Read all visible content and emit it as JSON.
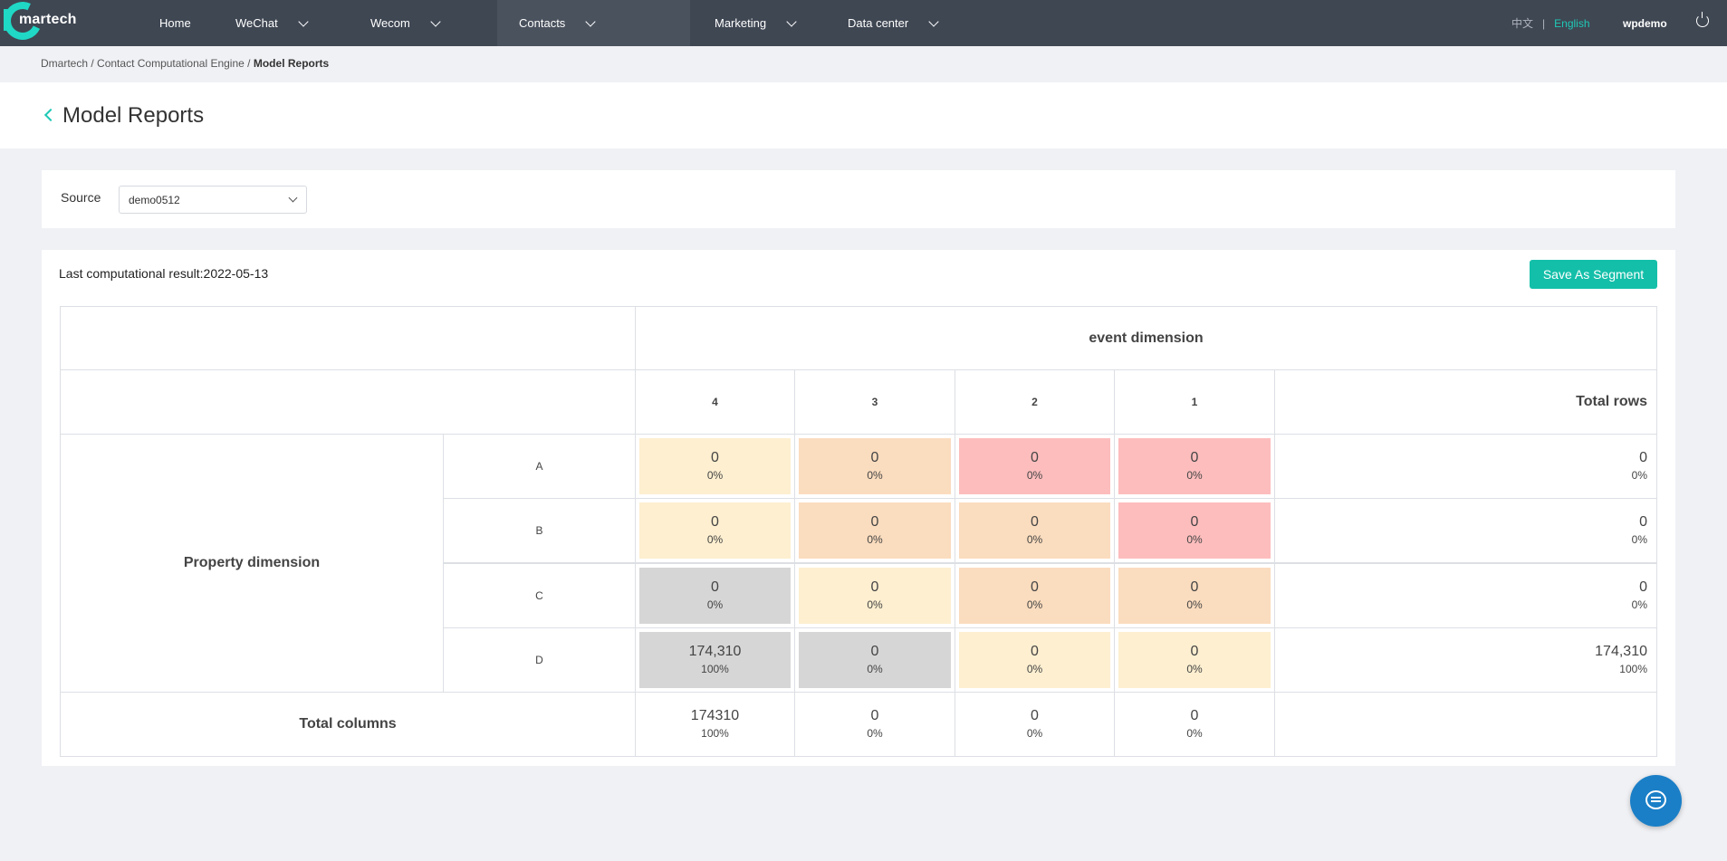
{
  "nav": {
    "logo_text": "martech",
    "items": [
      {
        "label": "Home",
        "has_chevron": false
      },
      {
        "label": "WeChat",
        "has_chevron": true
      },
      {
        "label": "Wecom",
        "has_chevron": true
      },
      {
        "label": "Contacts",
        "has_chevron": true,
        "active": true
      },
      {
        "label": "Marketing",
        "has_chevron": true
      },
      {
        "label": "Data center",
        "has_chevron": true
      }
    ],
    "lang_cn": "中文",
    "lang_sep": "|",
    "lang_en": "English",
    "user": "wpdemo"
  },
  "breadcrumb": {
    "items": [
      "Dmartech",
      "Contact Computational Engine"
    ],
    "separator": "/",
    "current": "Model Reports"
  },
  "page_title": "Model Reports",
  "source": {
    "label": "Source",
    "selected": "demo0512"
  },
  "report": {
    "last_result_label": "Last computational result:2022-05-13",
    "save_button": "Save As Segment",
    "event_dimension": "event dimension",
    "property_dimension": "Property dimension",
    "total_rows_label": "Total rows",
    "total_columns_label": "Total columns",
    "columns": [
      "4",
      "3",
      "2",
      "1"
    ],
    "rows": [
      {
        "label": "A",
        "cells": [
          {
            "v": "0",
            "p": "0%"
          },
          {
            "v": "0",
            "p": "0%"
          },
          {
            "v": "0",
            "p": "0%"
          },
          {
            "v": "0",
            "p": "0%"
          }
        ],
        "total": {
          "v": "0",
          "p": "0%"
        }
      },
      {
        "label": "B",
        "cells": [
          {
            "v": "0",
            "p": "0%"
          },
          {
            "v": "0",
            "p": "0%"
          },
          {
            "v": "0",
            "p": "0%"
          },
          {
            "v": "0",
            "p": "0%"
          }
        ],
        "total": {
          "v": "0",
          "p": "0%"
        }
      },
      {
        "label": "C",
        "cells": [
          {
            "v": "0",
            "p": "0%"
          },
          {
            "v": "0",
            "p": "0%"
          },
          {
            "v": "0",
            "p": "0%"
          },
          {
            "v": "0",
            "p": "0%"
          }
        ],
        "total": {
          "v": "0",
          "p": "0%"
        }
      },
      {
        "label": "D",
        "cells": [
          {
            "v": "174,310",
            "p": "100%"
          },
          {
            "v": "0",
            "p": "0%"
          },
          {
            "v": "0",
            "p": "0%"
          },
          {
            "v": "0",
            "p": "0%"
          }
        ],
        "total": {
          "v": "174,310",
          "p": "100%"
        }
      }
    ],
    "column_totals": [
      {
        "v": "174310",
        "p": "100%"
      },
      {
        "v": "0",
        "p": "0%"
      },
      {
        "v": "0",
        "p": "0%"
      },
      {
        "v": "0",
        "p": "0%"
      }
    ],
    "heat_colors": {
      "gray": "#d6d6d6",
      "light_yellow": "#fdefd0",
      "peach": "#fadcbe",
      "pink": "#fdbdbd"
    },
    "cell_colors": [
      [
        "light_yellow",
        "peach",
        "pink",
        "pink"
      ],
      [
        "light_yellow",
        "peach",
        "peach",
        "pink"
      ],
      [
        "gray",
        "light_yellow",
        "peach",
        "peach"
      ],
      [
        "gray",
        "gray",
        "light_yellow",
        "light_yellow"
      ]
    ]
  },
  "colors": {
    "nav_bg": "#3f4753",
    "accent": "#1fc9b6",
    "button": "#14bfa9",
    "chat_fab": "#1a7fc7"
  }
}
